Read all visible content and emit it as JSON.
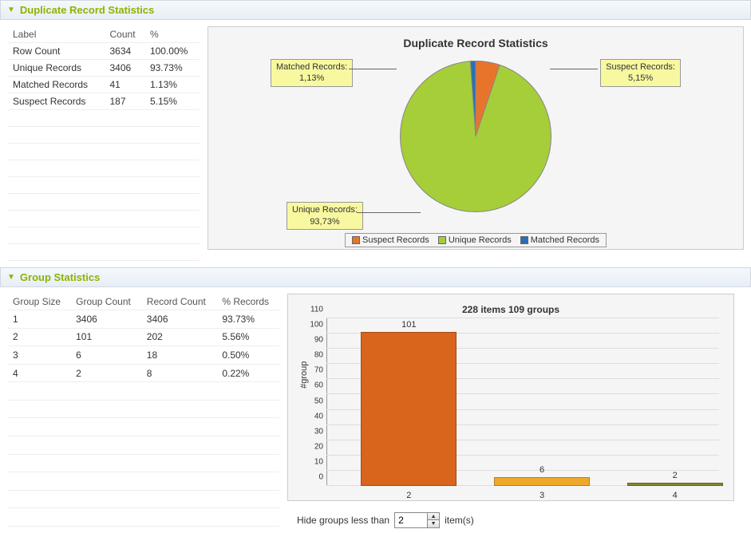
{
  "panels": {
    "duplicate": {
      "title": "Duplicate Record Statistics"
    },
    "group": {
      "title": "Group Statistics"
    }
  },
  "dup_table": {
    "headers": [
      "Label",
      "Count",
      "%"
    ],
    "rows": [
      {
        "label": "Row Count",
        "count": "3634",
        "pct": "100.00%"
      },
      {
        "label": "Unique Records",
        "count": "3406",
        "pct": "93.73%"
      },
      {
        "label": "Matched Records",
        "count": "41",
        "pct": "1.13%"
      },
      {
        "label": "Suspect Records",
        "count": "187",
        "pct": "5.15%"
      }
    ]
  },
  "group_table": {
    "headers": [
      "Group Size",
      "Group Count",
      "Record Count",
      "% Records"
    ],
    "rows": [
      {
        "size": "1",
        "gcount": "3406",
        "rcount": "3406",
        "pct": "93.73%"
      },
      {
        "size": "2",
        "gcount": "101",
        "rcount": "202",
        "pct": "5.56%"
      },
      {
        "size": "3",
        "gcount": "6",
        "rcount": "18",
        "pct": "0.50%"
      },
      {
        "size": "4",
        "gcount": "2",
        "rcount": "8",
        "pct": "0.22%"
      }
    ]
  },
  "pie": {
    "title": "Duplicate Record Statistics",
    "callouts": {
      "matched": "Matched Records:\n1,13%",
      "suspect": "Suspect Records:\n5,15%",
      "unique": "Unique Records:\n93,73%"
    },
    "legend": [
      "Suspect Records",
      "Unique Records",
      "Matched Records"
    ]
  },
  "bar": {
    "title": "228 items 109 groups",
    "ylabel": "#group",
    "hide_label_pre": "Hide groups less than",
    "hide_value": "2",
    "hide_label_post": "item(s)"
  },
  "chart_data": [
    {
      "type": "pie",
      "title": "Duplicate Record Statistics",
      "series": [
        {
          "name": "Unique Records",
          "value": 93.73,
          "color": "#a6ce39"
        },
        {
          "name": "Suspect Records",
          "value": 5.15,
          "color": "#e8742c"
        },
        {
          "name": "Matched Records",
          "value": 1.13,
          "color": "#2a6fb5"
        }
      ],
      "legend_position": "bottom"
    },
    {
      "type": "bar",
      "title": "228 items 109 groups",
      "ylabel": "#group",
      "xlabel": "",
      "ylim": [
        0,
        110
      ],
      "categories": [
        "2",
        "3",
        "4"
      ],
      "values": [
        101,
        6,
        2
      ],
      "colors": [
        "#d9641c",
        "#f0a828",
        "#86862f"
      ]
    }
  ],
  "colors": {
    "suspect": "#e8742c",
    "unique": "#a6ce39",
    "matched": "#2a6fb5"
  }
}
